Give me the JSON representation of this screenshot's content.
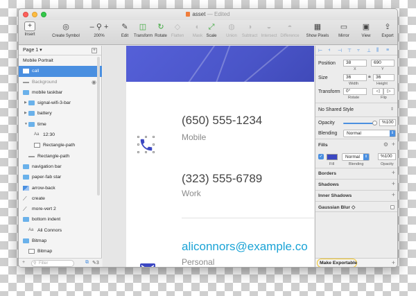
{
  "window": {
    "title": "asset",
    "status": "— Edited"
  },
  "toolbar": {
    "insert": "Insert",
    "create_symbol": "Create Symbol",
    "zoom_minus": "–",
    "zoom_plus": "+",
    "zoom": "200%",
    "edit": "Edit",
    "transform": "Transform",
    "rotate": "Rotate",
    "flatten": "Flatten",
    "mask": "Mask",
    "scale": "Scale",
    "union": "Union",
    "subtract": "Subtract",
    "intersect": "Intersect",
    "difference": "Difference",
    "show_pixels": "Show Pixels",
    "mirror": "Mirror",
    "view": "View",
    "export": "Export"
  },
  "sidebar": {
    "page": "Page 1",
    "page_chevron": "▾",
    "add_page": "+",
    "filter_placeholder": "Filter",
    "edit_count": "3",
    "layers": [
      {
        "label": "Mobile Portrait",
        "kind": "artboard",
        "indent": 0
      },
      {
        "label": "call",
        "kind": "shape",
        "indent": 0,
        "selected": true
      },
      {
        "label": "Background",
        "kind": "line",
        "indent": 0,
        "dim": true,
        "eye": true
      },
      {
        "label": "mobile taskbar",
        "kind": "folder",
        "indent": 0
      },
      {
        "label": "signal-wifi-3-bar",
        "kind": "folder",
        "indent": 1,
        "toggle": "▶"
      },
      {
        "label": "battery",
        "kind": "folder",
        "indent": 1,
        "toggle": "▶"
      },
      {
        "label": "time",
        "kind": "folder",
        "indent": 1,
        "toggle": "▼"
      },
      {
        "label": "12:30",
        "kind": "txt",
        "indent": 2
      },
      {
        "label": "Rectangle-path",
        "kind": "rect",
        "indent": 2
      },
      {
        "label": "Rectangle-path",
        "kind": "line",
        "indent": 1
      },
      {
        "label": "navigation bar",
        "kind": "folder",
        "indent": 0
      },
      {
        "label": "paper-fab star",
        "kind": "folder",
        "indent": 0
      },
      {
        "label": "arrow-back",
        "kind": "shape",
        "indent": 0
      },
      {
        "label": "create",
        "kind": "sym",
        "indent": 0
      },
      {
        "label": "more-vert 2",
        "kind": "sym",
        "indent": 0
      },
      {
        "label": "bottom indent",
        "kind": "folder",
        "indent": 0
      },
      {
        "label": "Ali Connors",
        "kind": "txt",
        "indent": 1
      },
      {
        "label": "Bitmap",
        "kind": "folder",
        "indent": 0
      },
      {
        "label": "Bitmap",
        "kind": "rect",
        "indent": 1
      },
      {
        "label": "Mask",
        "kind": "rect",
        "indent": 0,
        "toggle": "▶"
      }
    ]
  },
  "canvas": {
    "phone1": "(650) 555-1234",
    "phone1_label": "Mobile",
    "phone2": "(323) 555-6789",
    "phone2_label": "Work",
    "email": "aliconnors@example.co",
    "email_label": "Personal"
  },
  "inspector": {
    "position_label": "Position",
    "x": "38",
    "y": "690",
    "x_label": "X",
    "y_label": "Y",
    "size_label": "Size",
    "width": "36",
    "height": "36",
    "width_label": "Width",
    "height_label": "Height",
    "transform_label": "Transform",
    "rotate_value": "0°",
    "rotate_label": "Rotate",
    "flip_label": "Flip",
    "shared_style": "No Shared Style",
    "opacity_label": "Opacity",
    "opacity_value": "%100",
    "opacity": 1.0,
    "blending_label": "Blending",
    "blending_value": "Normal",
    "fills_title": "Fills",
    "fill_blend": "Normal",
    "fill_opacity": "%100",
    "fill_label": "Fill",
    "fill_blending_label": "Blending",
    "fill_opacity_label": "Opacity",
    "fill_color": "#3b47c2",
    "borders": "Borders",
    "shadows": "Shadows",
    "inner_shadows": "Inner Shadows",
    "gaussian_blur": "Gaussian Blur ◇",
    "make_exportable": "Make Exportable"
  },
  "colors": {
    "accent": "#4a8fe0",
    "hero": "#4a55c8",
    "email": "#1aa3d6",
    "highlight": "#f3c623"
  }
}
